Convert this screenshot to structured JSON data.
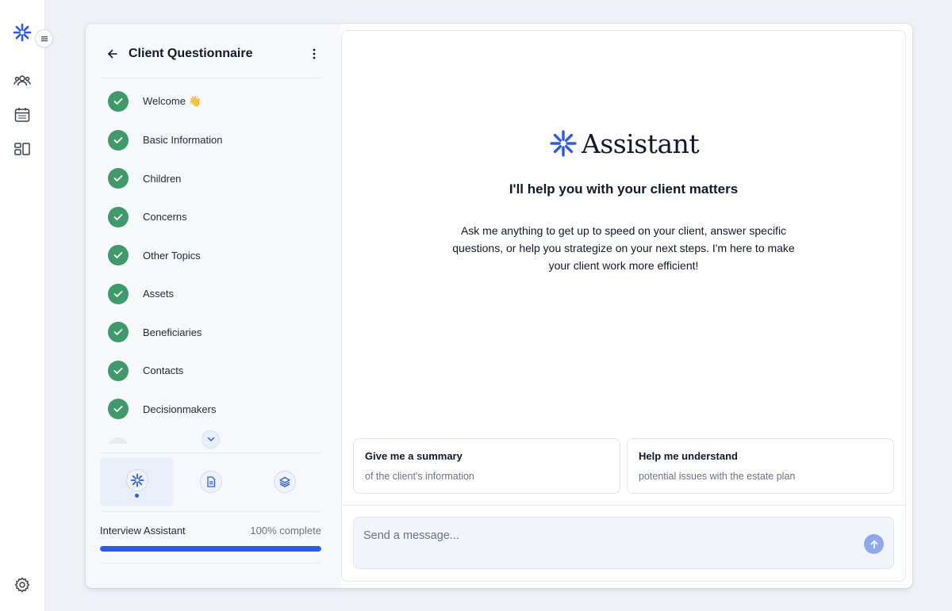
{
  "sidebar": {
    "logo_icon": "asterisk-logo-icon",
    "toggle_icon": "menu-icon",
    "nav_icons": [
      "people-icon",
      "calendar-icon",
      "dashboard-icon"
    ],
    "settings_icon": "gear-icon"
  },
  "questionnaire": {
    "title": "Client Questionnaire",
    "steps": [
      {
        "label": "Welcome 👋"
      },
      {
        "label": "Basic Information"
      },
      {
        "label": "Children"
      },
      {
        "label": "Concerns"
      },
      {
        "label": "Other Topics"
      },
      {
        "label": "Assets"
      },
      {
        "label": "Beneficiaries"
      },
      {
        "label": "Contacts"
      },
      {
        "label": "Decisionmakers"
      }
    ],
    "tabs": [
      "assistant-tab",
      "document-tab",
      "layers-tab"
    ],
    "progress": {
      "label": "Interview Assistant",
      "value_text": "100% complete",
      "percent": 100
    }
  },
  "assistant": {
    "brand_name": "Assistant",
    "headline": "I'll help you with your client matters",
    "intro": "Ask me anything to get up to speed on your client, answer specific questions, or help you strategize on your next steps. I'm here to make your client work more efficient!",
    "suggestions": [
      {
        "title": "Give me a summary",
        "subtitle": "of the client's information"
      },
      {
        "title": "Help me understand",
        "subtitle": "potential issues with the estate plan"
      }
    ],
    "composer": {
      "placeholder": "Send a message...",
      "value": ""
    }
  },
  "colors": {
    "accent": "#2d5be3",
    "check": "#3f9a6b",
    "background": "#eef2f7"
  }
}
